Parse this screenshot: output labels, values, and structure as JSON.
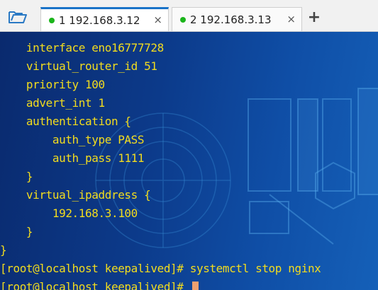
{
  "toolbar": {
    "open_icon": "folder-open-icon"
  },
  "tabs": [
    {
      "label": "1 192.168.3.12",
      "close": "×",
      "status_color": "#1bb51b",
      "active": true
    },
    {
      "label": "2 192.168.3.13",
      "close": "×",
      "status_color": "#1bb51b",
      "active": false
    }
  ],
  "add_tab_label": "+",
  "terminal": {
    "text_color": "#f2dc1e",
    "lines": [
      "    interface eno16777728",
      "    virtual_router_id 51",
      "    priority 100",
      "    advert_int 1",
      "    authentication {",
      "        auth_type PASS",
      "        auth_pass 1111",
      "    }",
      "    virtual_ipaddress {",
      "        192.168.3.100",
      "    }",
      "}",
      "[root@localhost keepalived]# systemctl stop nginx"
    ],
    "prompt": "[root@localhost keepalived]# "
  }
}
